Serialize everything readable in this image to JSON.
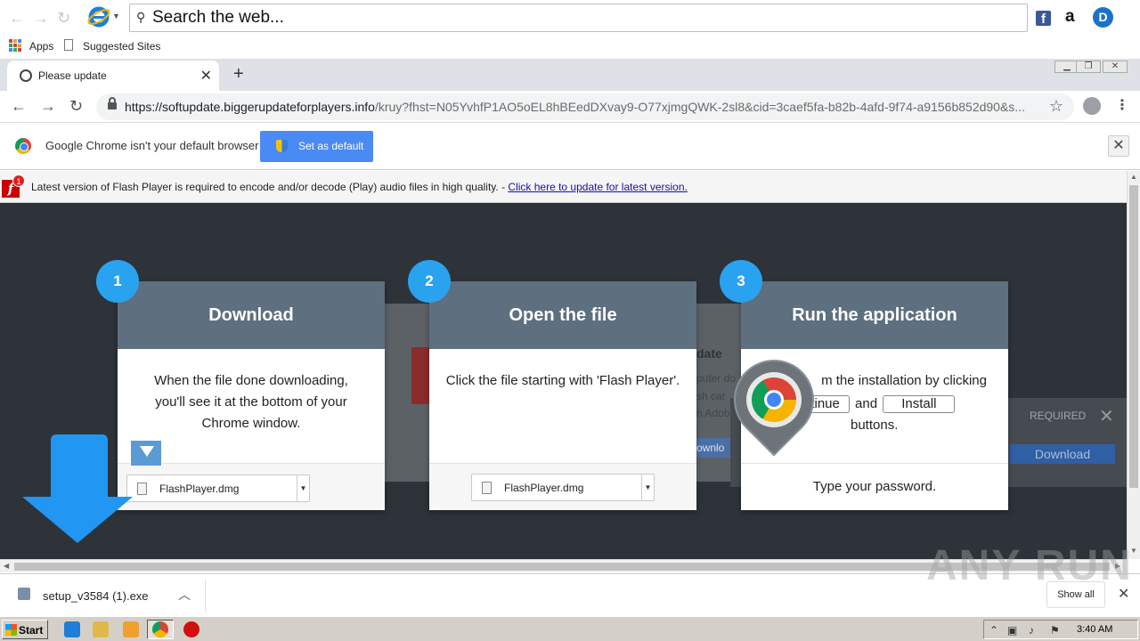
{
  "ie_toolbar": {
    "search_text": "Search the web..."
  },
  "bookmarks": {
    "apps_label": "Apps",
    "suggested_label": "Suggested Sites"
  },
  "tab": {
    "title": "Please update"
  },
  "omnibox": {
    "url_host": "https://softupdate.biggerupdateforplayers.info",
    "url_rest": "/kruy?fhst=N05YvhfP1AO5oEL8hBEedDXvay9-O77xjmgQWK-2sl8&cid=3caef5fa-b82b-4afd-9f74-a9156b852d90&s..."
  },
  "infobar": {
    "message": "Google Chrome isn't your default browser",
    "button_label": "Set as default"
  },
  "flash_bar": {
    "badge": "1",
    "message": "Latest version of Flash Player is required to encode and/or decode (Play) audio files in high quality. - ",
    "link": "Click here to update for latest version."
  },
  "background_popup": {
    "title": "date",
    "line1": "puter do",
    "line2": "sh car",
    "line3": "n Adob",
    "button": "ownlo",
    "required_label": "REQUIRED",
    "download_label": "Download"
  },
  "steps": [
    {
      "number": "1",
      "title": "Download",
      "body": "When the file done downloading, you'll see it at the bottom of your Chrome window.",
      "file_name": "FlashPlayer.dmg"
    },
    {
      "number": "2",
      "title": "Open the file",
      "body": "Click the file starting with 'Flash Player'.",
      "file_name": "FlashPlayer.dmg"
    },
    {
      "number": "3",
      "title": "Run the application",
      "body_prefix": "m the installation by clicking",
      "continue_label": "ntinue",
      "and_label": "and",
      "install_label": "Install",
      "body_suffix": "buttons.",
      "footer": "Type your password."
    }
  ],
  "download_shelf": {
    "file_name": "setup_v3584 (1).exe",
    "show_all_label": "Show all",
    "watermark": "ANY RUN"
  },
  "taskbar": {
    "start_label": "Start",
    "clock": "3:40 AM"
  },
  "colors": {
    "accent_blue": "#29a3f0",
    "card_header": "#5e6f7f",
    "page_bg": "#2e3339",
    "button_blue": "#4a8af4"
  }
}
